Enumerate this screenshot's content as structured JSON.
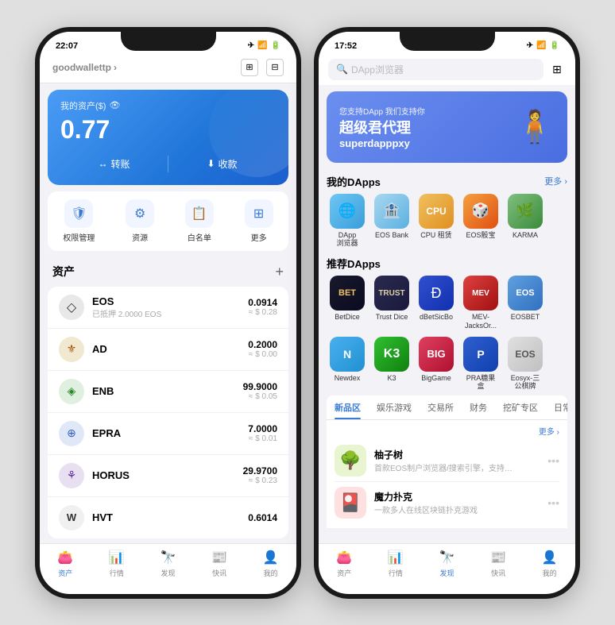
{
  "phone1": {
    "statusBar": {
      "time": "22:07",
      "icons": "✈ ☁ 🔋"
    },
    "header": {
      "walletName": "goodwallettp",
      "chevron": "›"
    },
    "balanceCard": {
      "label": "我的资产($)",
      "amount": "0.77",
      "transferBtn": "转账",
      "receiveBtn": "收款"
    },
    "quickActions": [
      {
        "label": "权限管理",
        "icon": "🛡"
      },
      {
        "label": "资源",
        "icon": "⚙"
      },
      {
        "label": "白名单",
        "icon": "📋"
      },
      {
        "label": "更多",
        "icon": "⊞"
      }
    ],
    "assetsSection": {
      "title": "资产",
      "addIcon": "+"
    },
    "assets": [
      {
        "name": "EOS",
        "sub": "已抵押 2.0000 EOS",
        "amount": "0.0914",
        "usd": "≈ $ 0.28",
        "icon": "◇",
        "iconClass": "eos-icon"
      },
      {
        "name": "AD",
        "sub": "",
        "amount": "0.2000",
        "usd": "≈ $ 0.00",
        "icon": "⚜",
        "iconClass": "ad-icon"
      },
      {
        "name": "ENB",
        "sub": "",
        "amount": "99.9000",
        "usd": "≈ $ 0.05",
        "icon": "◈",
        "iconClass": "enb-icon"
      },
      {
        "name": "EPRA",
        "sub": "",
        "amount": "7.0000",
        "usd": "≈ $ 0.01",
        "icon": "⊕",
        "iconClass": "epra-icon"
      },
      {
        "name": "HORUS",
        "sub": "",
        "amount": "29.9700",
        "usd": "≈ $ 0.23",
        "icon": "⚘",
        "iconClass": "horus-icon"
      },
      {
        "name": "HVT",
        "sub": "",
        "amount": "0.6014",
        "usd": "",
        "icon": "W",
        "iconClass": "hvt-icon"
      }
    ],
    "bottomNav": [
      {
        "label": "资产",
        "icon": "👛",
        "active": true
      },
      {
        "label": "行情",
        "icon": "📊",
        "active": false
      },
      {
        "label": "发现",
        "icon": "🔭",
        "active": false
      },
      {
        "label": "快讯",
        "icon": "📰",
        "active": false
      },
      {
        "label": "我的",
        "icon": "👤",
        "active": false
      }
    ]
  },
  "phone2": {
    "statusBar": {
      "time": "17:52",
      "icons": "✈ ☁ 🔋"
    },
    "searchBar": {
      "placeholder": "DApp浏览器"
    },
    "banner": {
      "sub": "您支持DApp 我们支持你",
      "title": "超级君代理",
      "title2": "superdapppxy",
      "figure": "🧍"
    },
    "myDapps": {
      "sectionTitle": "我的DApps",
      "more": "更多 ›",
      "items": [
        {
          "label": "DApp\n浏览器",
          "iconClass": "browser",
          "icon": "🌐"
        },
        {
          "label": "EOS Bank",
          "iconClass": "eosbank",
          "icon": "🏦"
        },
        {
          "label": "CPU 租赁",
          "iconClass": "cpu",
          "icon": "💻"
        },
        {
          "label": "EOS骰宝",
          "iconClass": "eossibo",
          "icon": "🎲"
        },
        {
          "label": "KARMA",
          "iconClass": "karma",
          "icon": "🌿"
        }
      ]
    },
    "recommendedDapps": {
      "sectionTitle": "推荐DApps",
      "row1": [
        {
          "label": "BetDice",
          "iconClass": "betdice",
          "icon": "🎲"
        },
        {
          "label": "Trust Dice",
          "iconClass": "trustdice",
          "icon": "🎯"
        },
        {
          "label": "dBetSicBo",
          "iconClass": "dbetsicbo",
          "icon": "Ð"
        },
        {
          "label": "MEV-\nJacksOr...",
          "iconClass": "mev",
          "icon": "♠"
        },
        {
          "label": "EOSBET",
          "iconClass": "eosbet",
          "icon": "◆"
        }
      ],
      "row2": [
        {
          "label": "Newdex",
          "iconClass": "newdex",
          "icon": "N"
        },
        {
          "label": "K3",
          "iconClass": "k3",
          "icon": "K"
        },
        {
          "label": "BigGame",
          "iconClass": "biggame",
          "icon": "B"
        },
        {
          "label": "PRA糖果\n盒",
          "iconClass": "pra",
          "icon": "P"
        },
        {
          "label": "Eosyx-三\n公棋牌",
          "iconClass": "eosyx",
          "icon": "E"
        }
      ]
    },
    "tabs": [
      {
        "label": "新品区",
        "active": true
      },
      {
        "label": "娱乐游戏",
        "active": false
      },
      {
        "label": "交易所",
        "active": false
      },
      {
        "label": "财务",
        "active": false
      },
      {
        "label": "挖矿专区",
        "active": false
      },
      {
        "label": "日常工...",
        "active": false
      }
    ],
    "newApps": {
      "more": "更多 ›",
      "items": [
        {
          "name": "柚子树",
          "desc": "首款EOS制户浏览器/搜索引擎，支持接关...",
          "icon": "🌳",
          "bg": "#f0f8e0"
        },
        {
          "name": "魔力扑克",
          "desc": "一款多人在线区块链扑克游戏",
          "icon": "🎴",
          "bg": "#ffe0e0"
        }
      ]
    },
    "bottomNav": [
      {
        "label": "资产",
        "icon": "👛",
        "active": false
      },
      {
        "label": "行情",
        "icon": "📊",
        "active": false
      },
      {
        "label": "发现",
        "icon": "🔭",
        "active": true
      },
      {
        "label": "快讯",
        "icon": "📰",
        "active": false
      },
      {
        "label": "我的",
        "icon": "👤",
        "active": false
      }
    ]
  }
}
